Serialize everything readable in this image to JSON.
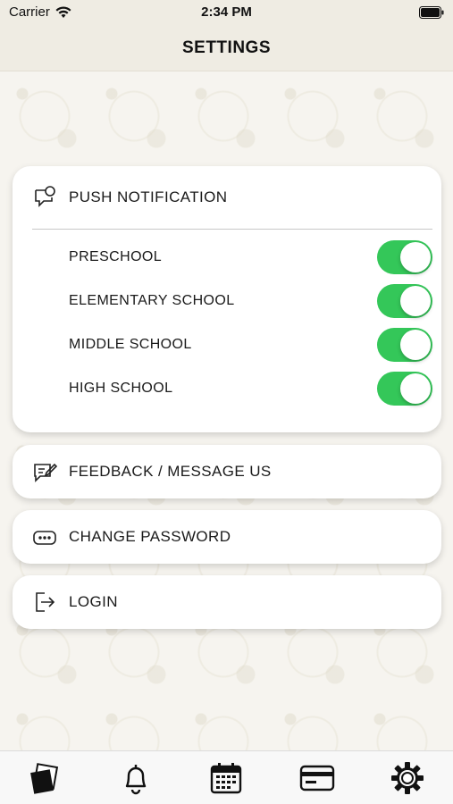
{
  "status_bar": {
    "carrier": "Carrier",
    "time": "2:34 PM"
  },
  "nav": {
    "title": "SETTINGS"
  },
  "push": {
    "title": "PUSH NOTIFICATION",
    "icon": "chat-bubble-icon",
    "items": [
      {
        "label": "PRESCHOOL",
        "enabled": true
      },
      {
        "label": "ELEMENTARY SCHOOL",
        "enabled": true
      },
      {
        "label": "MIDDLE SCHOOL",
        "enabled": true
      },
      {
        "label": "HIGH SCHOOL",
        "enabled": true
      }
    ]
  },
  "actions": {
    "feedback": {
      "label": "FEEDBACK / MESSAGE US",
      "icon": "message-edit-icon"
    },
    "change_password": {
      "label": "CHANGE PASSWORD",
      "icon": "password-dots-icon"
    },
    "login": {
      "label": "LOGIN",
      "icon": "login-arrow-icon"
    }
  },
  "tabs": [
    {
      "name": "cards-icon"
    },
    {
      "name": "bell-icon"
    },
    {
      "name": "calendar-icon"
    },
    {
      "name": "credit-card-icon"
    },
    {
      "name": "gear-icon"
    }
  ],
  "colors": {
    "toggle_on": "#34c759",
    "header_bg": "#efece3"
  }
}
